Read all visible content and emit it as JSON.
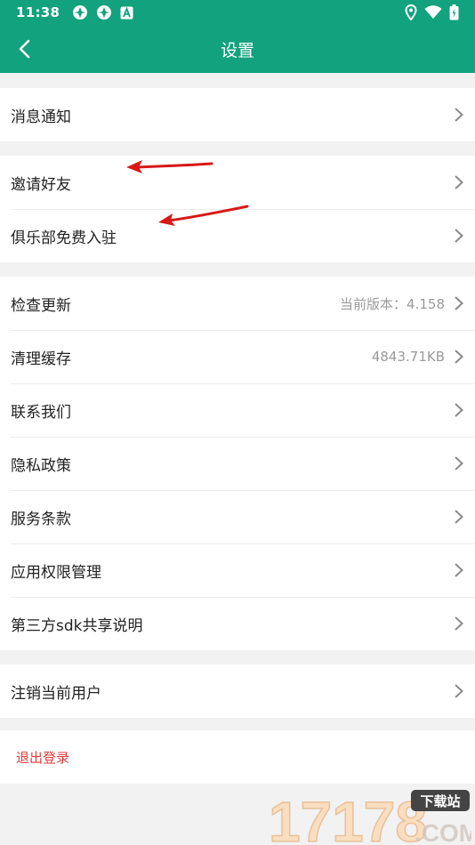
{
  "status_bar": {
    "time": "11:38"
  },
  "header": {
    "title": "设置"
  },
  "groups": [
    {
      "items": [
        {
          "label": "消息通知",
          "value": ""
        }
      ]
    },
    {
      "items": [
        {
          "label": "邀请好友",
          "value": ""
        },
        {
          "label": "俱乐部免费入驻",
          "value": ""
        }
      ]
    },
    {
      "items": [
        {
          "label": "检查更新",
          "value": "当前版本：4.158"
        },
        {
          "label": "清理缓存",
          "value": "4843.71KB"
        },
        {
          "label": "联系我们",
          "value": ""
        },
        {
          "label": "隐私政策",
          "value": ""
        },
        {
          "label": "服务条款",
          "value": ""
        },
        {
          "label": "应用权限管理",
          "value": ""
        },
        {
          "label": "第三方sdk共享说明",
          "value": ""
        }
      ]
    },
    {
      "items": [
        {
          "label": "注销当前用户",
          "value": ""
        }
      ]
    }
  ],
  "logout": {
    "label": "退出登录",
    "color": "#e23b3b"
  },
  "watermark": {
    "brand": "17178",
    "tag": "下载站",
    "domain": ".COM"
  },
  "colors": {
    "brand": "#12a27d",
    "annotation": "#d81818"
  }
}
